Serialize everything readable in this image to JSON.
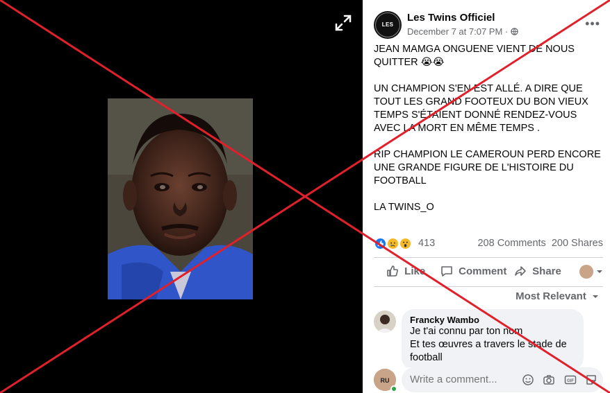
{
  "post": {
    "page_name": "Les Twins Officiel",
    "avatar_text": "LES TWINS",
    "timestamp": "December 7 at 7:07 PM",
    "privacy_separator": "·",
    "paragraphs": [
      "JEAN MAMGA ONGUENE VIENT DE NOUS QUITTER 😭😭",
      "UN CHAMPION S'EN EST ALLÉ. A DIRE QUE TOUT LES GRAND FOOTEUX DU BON VIEUX TEMPS S'ÉTAIENT DONNÉ RENDEZ-VOUS AVEC LA MORT EN MÊME TEMPS .",
      "RIP CHAMPION LE CAMEROUN PERD ENCORE UNE GRANDE FIGURE DE L'HISTOIRE DU FOOTBALL",
      "LA TWINS_O"
    ]
  },
  "stats": {
    "reactions_count": "413",
    "comments": "208 Comments",
    "shares": "200 Shares"
  },
  "actions": {
    "like": "Like",
    "comment": "Comment",
    "share": "Share"
  },
  "comments": {
    "sort_label": "Most Relevant",
    "items": [
      {
        "author": "Francky Wambo",
        "lines": [
          "Je t'ai connu par ton nom",
          "Et tes œuvres a travers le stade de football"
        ]
      }
    ]
  },
  "writer": {
    "placeholder": "Write a comment...",
    "avatar_text": "RU"
  },
  "colors": {
    "cross": "#e0202a",
    "facebook_blue": "#1877f2",
    "muted": "#65676b"
  }
}
